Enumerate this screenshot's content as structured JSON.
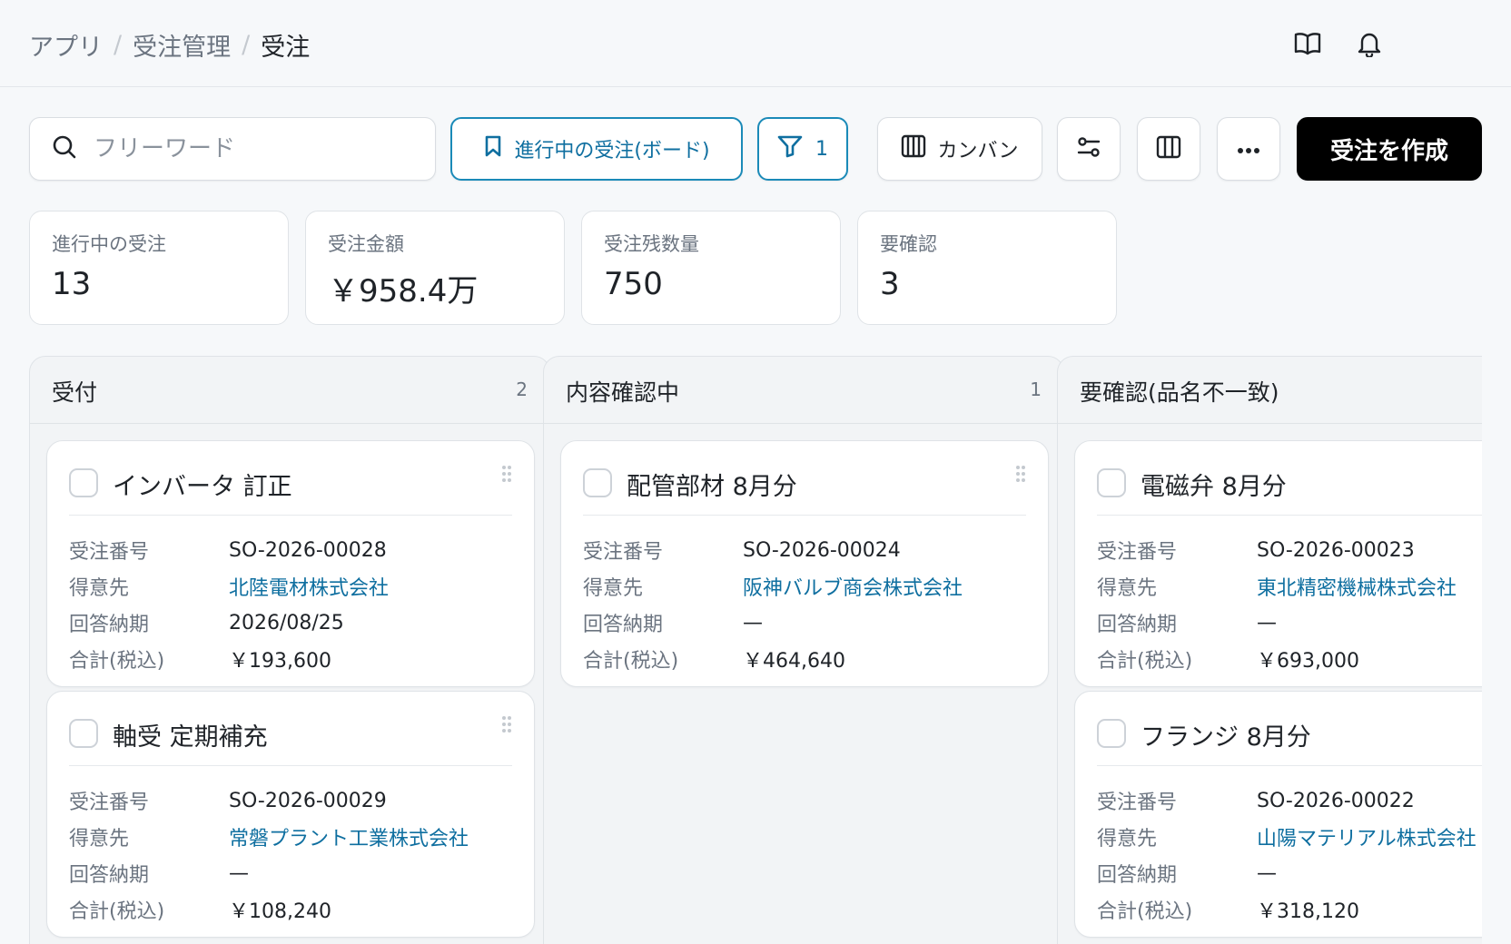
{
  "breadcrumb": {
    "items": [
      "アプリ",
      "受注管理",
      "受注"
    ],
    "separator": "/"
  },
  "header_icons": {
    "docs": "book-open-icon",
    "notifications": "bell-icon"
  },
  "toolbar": {
    "search_placeholder": "フリーワード",
    "saved_view_label": "進行中の受注(ボード)",
    "filter_count": "1",
    "view_mode_label": "カンバン",
    "create_label": "受注を作成"
  },
  "stats": [
    {
      "label": "進行中の受注",
      "value": "13"
    },
    {
      "label": "受注金額",
      "value": "￥958.4万"
    },
    {
      "label": "受注残数量",
      "value": "750"
    },
    {
      "label": "要確認",
      "value": "3"
    }
  ],
  "field_labels": {
    "order_no": "受注番号",
    "customer": "得意先",
    "due": "回答納期",
    "total": "合計(税込)"
  },
  "columns": [
    {
      "title": "受付",
      "count": "2",
      "cards": [
        {
          "title": "インバータ 訂正",
          "order_no": "SO-2026-00028",
          "customer": "北陸電材株式会社",
          "due": "2026/08/25",
          "total": "￥193,600"
        },
        {
          "title": "軸受 定期補充",
          "order_no": "SO-2026-00029",
          "customer": "常磐プラント工業株式会社",
          "due": "—",
          "total": "￥108,240"
        }
      ]
    },
    {
      "title": "内容確認中",
      "count": "1",
      "cards": [
        {
          "title": "配管部材 8月分",
          "order_no": "SO-2026-00024",
          "customer": "阪神バルブ商会株式会社",
          "due": "—",
          "total": "￥464,640"
        }
      ]
    },
    {
      "title": "要確認(品名不一致)",
      "count": "",
      "cards": [
        {
          "title": "電磁弁 8月分",
          "order_no": "SO-2026-00023",
          "customer": "東北精密機械株式会社",
          "due": "—",
          "total": "￥693,000"
        },
        {
          "title": "フランジ 8月分",
          "order_no": "SO-2026-00022",
          "customer": "山陽マテリアル株式会社",
          "due": "—",
          "total": "￥318,120"
        }
      ]
    }
  ],
  "colors": {
    "accent": "#1a8ab8",
    "link": "#0f6fa0",
    "primary_button": "#000000"
  }
}
